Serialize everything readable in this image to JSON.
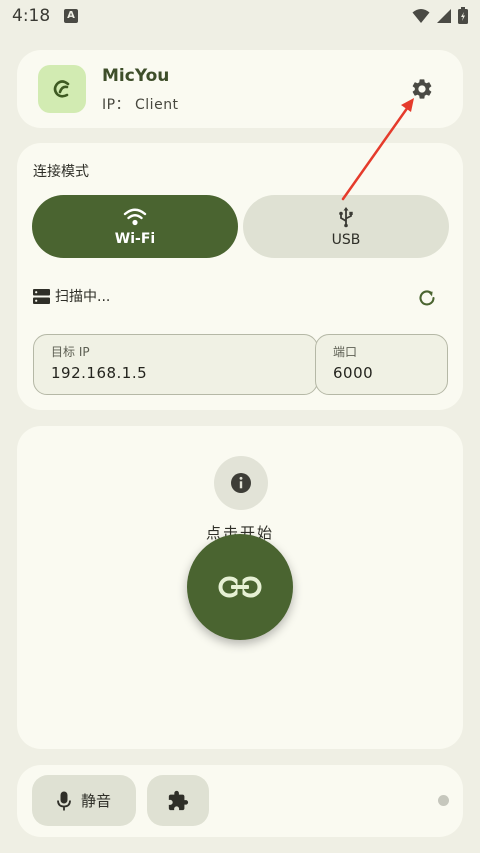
{
  "status_bar": {
    "time": "4:18",
    "notification_glyph": "A"
  },
  "header": {
    "app_name": "MicYou",
    "ip_text": "IP： Client",
    "settings_icon": "gear-icon"
  },
  "connection": {
    "title": "连接模式",
    "modes": [
      {
        "label": "Wi-Fi",
        "icon": "wifi-icon",
        "selected": true
      },
      {
        "label": "USB",
        "icon": "usb-icon",
        "selected": false
      }
    ],
    "scan_status": "扫描中...",
    "target_ip": {
      "label": "目标 IP",
      "value": "192.168.1.5"
    },
    "port": {
      "label": "端口",
      "value": "6000"
    }
  },
  "main": {
    "prompt": "点击开始",
    "connect_icon": "link-icon",
    "info_icon": "info-icon"
  },
  "bottom": {
    "mute_label": "静音",
    "mic_icon": "mic-icon",
    "plugin_icon": "puzzle-icon"
  },
  "colors": {
    "accent": "#4a6430",
    "annotation_arrow": "#e53b2c",
    "background": "#efefe4",
    "card": "#fafaf1"
  }
}
